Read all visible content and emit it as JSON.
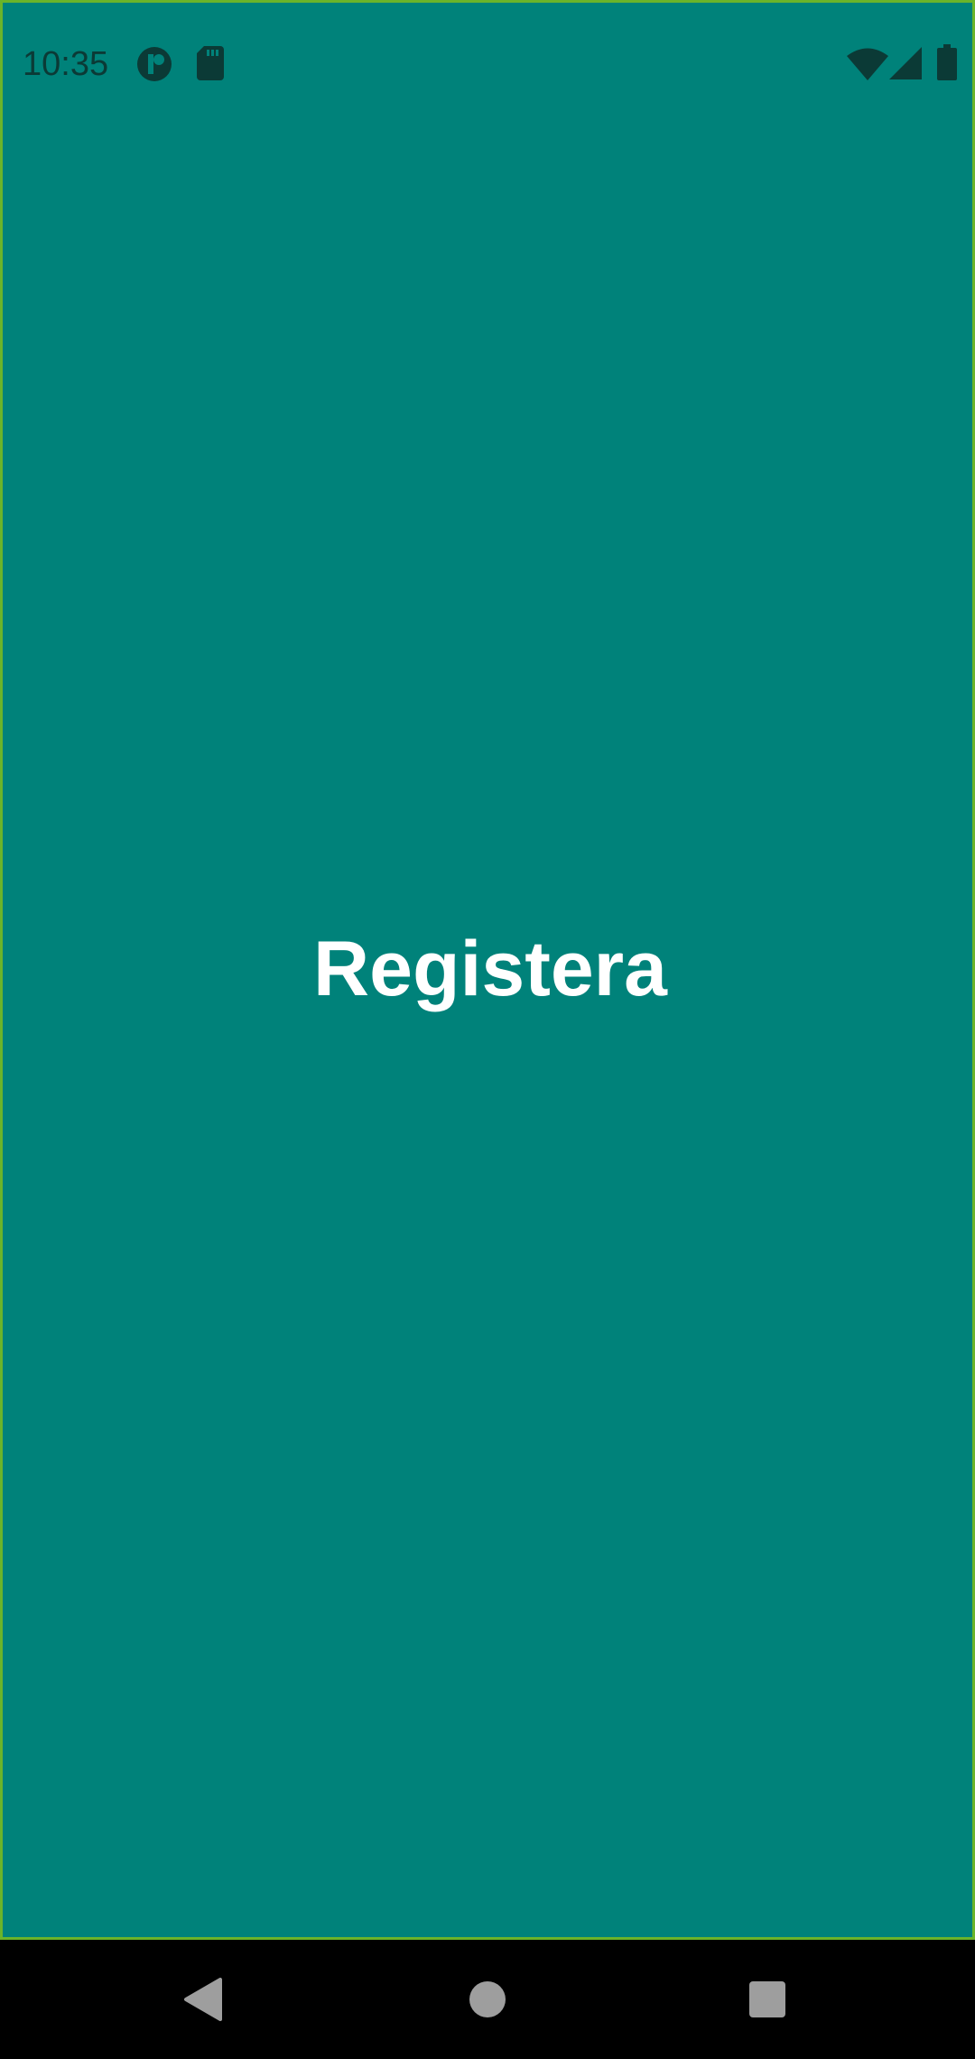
{
  "status_bar": {
    "time": "10:35",
    "left_icons": [
      "app-notification-icon",
      "sd-card-icon"
    ],
    "right_icons": [
      "wifi-icon",
      "cellular-signal-icon",
      "battery-icon"
    ]
  },
  "main": {
    "title": "Registera"
  },
  "navigation_bar": {
    "buttons": [
      "back-icon",
      "home-icon",
      "recents-icon"
    ]
  },
  "colors": {
    "background": "#00827a",
    "border": "#6ab42a",
    "title": "#ffffff",
    "status_icons": "#0b3a36",
    "nav_background": "#000000",
    "nav_buttons": "#9e9e9e"
  }
}
